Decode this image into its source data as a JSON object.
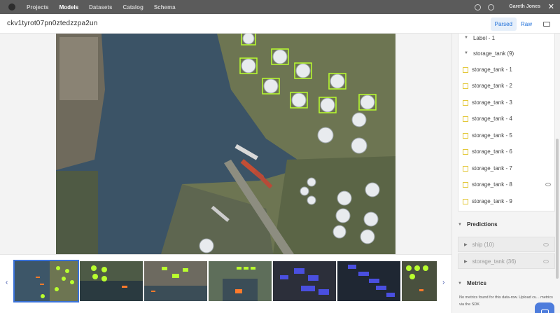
{
  "nav": {
    "items": [
      "Projects",
      "Models",
      "Datasets",
      "Catalog",
      "Schema"
    ],
    "active": "Models",
    "user": "Gareth Jones",
    "close_symbol": "✕"
  },
  "modal": {
    "title": "ckv1tyrot07pn0ztedzzpa2un",
    "view_parsed": "Parsed",
    "view_raw": "Raw"
  },
  "thumbs": {
    "prev": "‹",
    "next": "›"
  },
  "panel": {
    "label_group": "Label - 1",
    "class_group": "storage_tank (9)",
    "items": [
      "storage_tank - 1",
      "storage_tank - 2",
      "storage_tank - 3",
      "storage_tank - 4",
      "storage_tank - 5",
      "storage_tank - 6",
      "storage_tank - 7",
      "storage_tank - 8",
      "storage_tank - 9"
    ],
    "predictions_title": "Predictions",
    "predictions": [
      "ship (10)",
      "storage_tank (36)"
    ],
    "metrics_title": "Metrics",
    "metrics_message": "No metrics found for this data-row. Upload cu... metrics via the SDK"
  },
  "colors": {
    "accent": "#1e6fd9",
    "annotation": "#b9ff2e",
    "prediction": "#5560ff"
  },
  "icons": [
    "help-icon",
    "notification-icon",
    "close-icon",
    "keyboard-icon",
    "eye-icon",
    "eye-off-icon",
    "chat-icon"
  ]
}
